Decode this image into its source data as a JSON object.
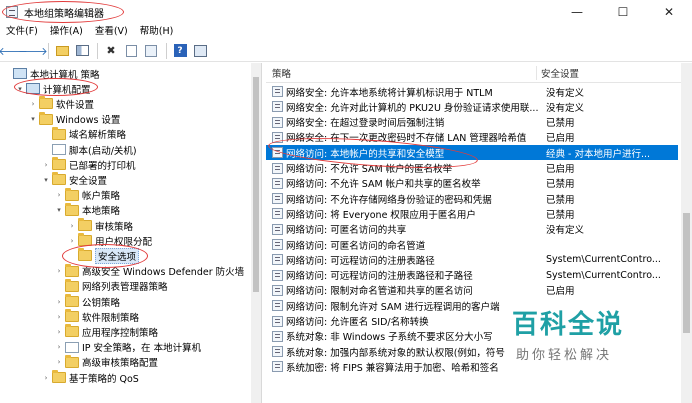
{
  "window": {
    "title": "本地组策略编辑器",
    "controls": {
      "minimize": "—",
      "maximize": "☐",
      "close": "✕"
    }
  },
  "menu": [
    "文件(F)",
    "操作(A)",
    "查看(V)",
    "帮助(H)"
  ],
  "toolbar_icons": [
    "back-arrow-icon",
    "forward-arrow-icon",
    "up-folder-icon",
    "show-hide-tree-icon",
    "delete-icon",
    "properties-icon",
    "export-list-icon",
    "help-icon",
    "view-icon"
  ],
  "tree": [
    {
      "label": "本地计算机 策略",
      "icon": "computer",
      "expander": "",
      "indent": 0
    },
    {
      "label": "计算机配置",
      "icon": "computer",
      "expander": "▾",
      "indent": 1
    },
    {
      "label": "软件设置",
      "icon": "folder",
      "expander": "›",
      "indent": 2
    },
    {
      "label": "Windows 设置",
      "icon": "folder",
      "expander": "▾",
      "indent": 2
    },
    {
      "label": "域名解析策略",
      "icon": "folder",
      "expander": "",
      "indent": 3
    },
    {
      "label": "脚本(启动/关机)",
      "icon": "doc",
      "expander": "",
      "indent": 3
    },
    {
      "label": "已部署的打印机",
      "icon": "folder",
      "expander": "›",
      "indent": 3
    },
    {
      "label": "安全设置",
      "icon": "folder",
      "expander": "▾",
      "indent": 3
    },
    {
      "label": "帐户策略",
      "icon": "folder",
      "expander": "›",
      "indent": 4
    },
    {
      "label": "本地策略",
      "icon": "folder",
      "expander": "▾",
      "indent": 4
    },
    {
      "label": "审核策略",
      "icon": "folder",
      "expander": "›",
      "indent": 5
    },
    {
      "label": "用户权限分配",
      "icon": "folder",
      "expander": "›",
      "indent": 5
    },
    {
      "label": "安全选项",
      "icon": "folder",
      "expander": "",
      "indent": 5,
      "selected": true
    },
    {
      "label": "高级安全 Windows Defender 防火墙",
      "icon": "folder",
      "expander": "›",
      "indent": 4
    },
    {
      "label": "网络列表管理器策略",
      "icon": "folder",
      "expander": "",
      "indent": 4
    },
    {
      "label": "公钥策略",
      "icon": "folder",
      "expander": "›",
      "indent": 4
    },
    {
      "label": "软件限制策略",
      "icon": "folder",
      "expander": "›",
      "indent": 4
    },
    {
      "label": "应用程序控制策略",
      "icon": "folder",
      "expander": "›",
      "indent": 4
    },
    {
      "label": "IP 安全策略，在 本地计算机",
      "icon": "doc",
      "expander": "›",
      "indent": 4
    },
    {
      "label": "高级审核策略配置",
      "icon": "folder",
      "expander": "›",
      "indent": 4
    },
    {
      "label": "基于策略的 QoS",
      "icon": "folder",
      "expander": "›",
      "indent": 3
    }
  ],
  "columns": {
    "policy": "策略",
    "setting": "安全设置"
  },
  "policies": [
    {
      "name": "网络安全: 允许本地系统将计算机标识用于 NTLM",
      "value": "没有定义"
    },
    {
      "name": "网络安全: 允许对此计算机的 PKU2U 身份验证请求使用联...",
      "value": "没有定义"
    },
    {
      "name": "网络安全: 在超过登录时间后强制注销",
      "value": "已禁用"
    },
    {
      "name": "网络安全: 在下一次更改密码时不存储 LAN 管理器哈希值",
      "value": "已启用"
    },
    {
      "name": "网络访问: 本地帐户的共享和安全模型",
      "value": "经典 - 对本地用户进行...",
      "active": true
    },
    {
      "name": "网络访问: 不允许 SAM 帐户的匿名枚举",
      "value": "已启用"
    },
    {
      "name": "网络访问: 不允许 SAM 帐户和共享的匿名枚举",
      "value": "已禁用"
    },
    {
      "name": "网络访问: 不允许存储网络身份验证的密码和凭据",
      "value": "已禁用"
    },
    {
      "name": "网络访问: 将 Everyone 权限应用于匿名用户",
      "value": "已禁用"
    },
    {
      "name": "网络访问: 可匿名访问的共享",
      "value": "没有定义"
    },
    {
      "name": "网络访问: 可匿名访问的命名管道",
      "value": ""
    },
    {
      "name": "网络访问: 可远程访问的注册表路径",
      "value": "System\\CurrentContro..."
    },
    {
      "name": "网络访问: 可远程访问的注册表路径和子路径",
      "value": "System\\CurrentContro..."
    },
    {
      "name": "网络访问: 限制对命名管道和共享的匿名访问",
      "value": "已启用"
    },
    {
      "name": "网络访问: 限制允许对 SAM 进行远程调用的客户端",
      "value": ""
    },
    {
      "name": "网络访问: 允许匿名 SID/名称转换",
      "value": ""
    },
    {
      "name": "系统对象: 非 Windows 子系统不要求区分大小写",
      "value": ""
    },
    {
      "name": "系统对象: 加强内部系统对象的默认权限(例如，符号",
      "value": ""
    },
    {
      "name": "系统加密: 将 FIPS 兼容算法用于加密、哈希和签名",
      "value": ""
    }
  ],
  "watermark": {
    "brand": "百科全说",
    "slogan": "助你轻松解决"
  },
  "colors": {
    "selection": "#0078d7",
    "annotation": "#e23b3b",
    "watermark": "#1fa0a5"
  }
}
